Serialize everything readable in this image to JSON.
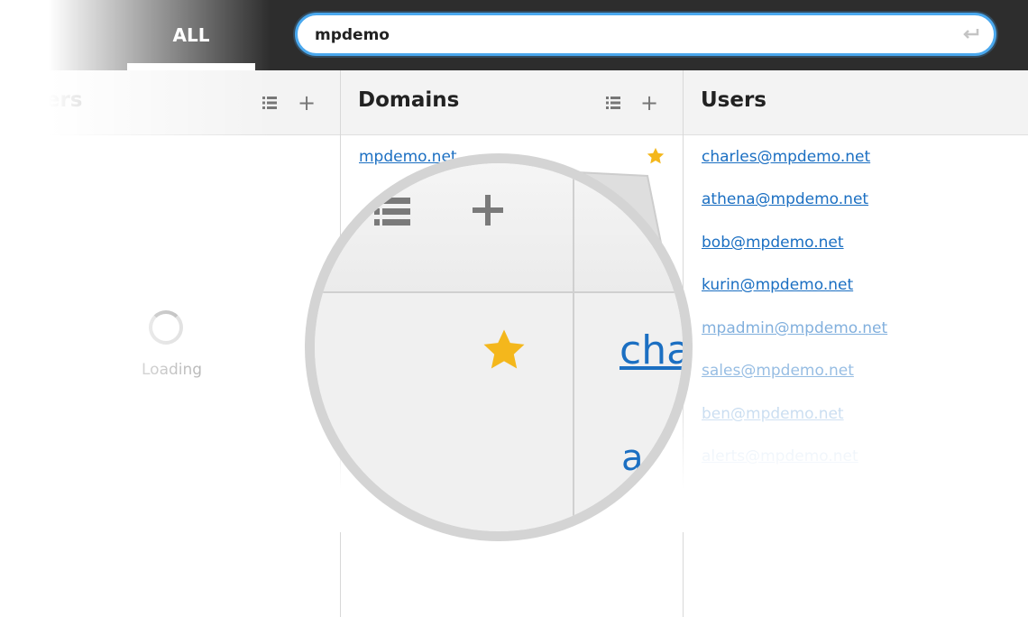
{
  "topbar": {
    "tabs": [
      {
        "label": ""
      },
      {
        "label": "ALL",
        "active": true
      }
    ],
    "search": {
      "value": "mpdemo",
      "placeholder": ""
    },
    "accent_color": "#4aa8ee"
  },
  "customers": {
    "title": "tomers",
    "loading_text": "Loading"
  },
  "domains": {
    "title": "Domains",
    "items": [
      {
        "label": "mpdemo.net",
        "favorite": true
      }
    ]
  },
  "users": {
    "title": "Users",
    "items": [
      {
        "label": "charles@mpdemo.net"
      },
      {
        "label": "athena@mpdemo.net"
      },
      {
        "label": "bob@mpdemo.net"
      },
      {
        "label": "kurin@mpdemo.net"
      },
      {
        "label": "mpadmin@mpdemo.net"
      },
      {
        "label": "sales@mpdemo.net"
      },
      {
        "label": "ben@mpdemo.net"
      },
      {
        "label": "alerts@mpdemo.net"
      }
    ]
  },
  "magnifier": {
    "link_fragment": "cha",
    "link_fragment_2": "a"
  },
  "colors": {
    "link": "#1b6fc2",
    "star": "#f4b71c",
    "topbar": "#2d2d2d"
  },
  "icons": [
    "list-icon",
    "plus-icon",
    "star-icon",
    "enter-icon",
    "loading-spinner"
  ]
}
